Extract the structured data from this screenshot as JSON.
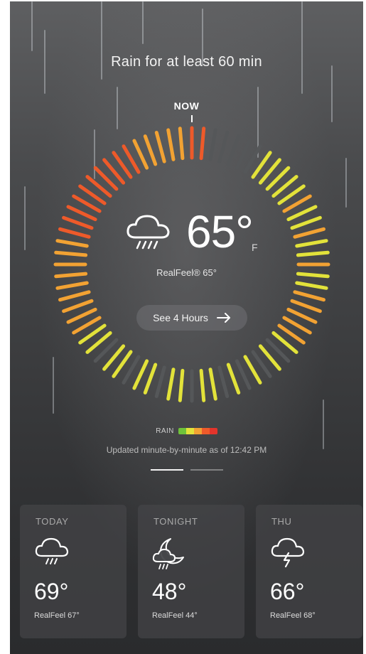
{
  "headline": "Rain for at least 60 min",
  "now_label": "NOW",
  "current": {
    "icon": "rain-cloud-icon",
    "temperature": "65°",
    "unit": "F",
    "realfeel": "RealFeel® 65°"
  },
  "see_hours_label": "See 4 Hours",
  "legend": {
    "label": "RAIN",
    "colors": [
      "#6fc23a",
      "#e2e23a",
      "#f2a233",
      "#ee5a2a",
      "#e3342b"
    ]
  },
  "updated_text": "Updated minute-by-minute as of 12:42 PM",
  "pager": {
    "count": 2,
    "active": 0
  },
  "forecast": [
    {
      "label": "TODAY",
      "icon": "rain-cloud-icon",
      "temp": "69°",
      "realfeel": "RealFeel 67°"
    },
    {
      "label": "TONIGHT",
      "icon": "night-rain-icon",
      "temp": "48°",
      "realfeel": "RealFeel 44°"
    },
    {
      "label": "THU",
      "icon": "thunderstorm-icon",
      "temp": "66°",
      "realfeel": "RealFeel 68°"
    }
  ],
  "colors": {
    "rain_dry": "#555759",
    "rain_light": "#e2e23a",
    "rain_moderate": "#f2a233",
    "rain_heavy": "#ee5a2a"
  }
}
